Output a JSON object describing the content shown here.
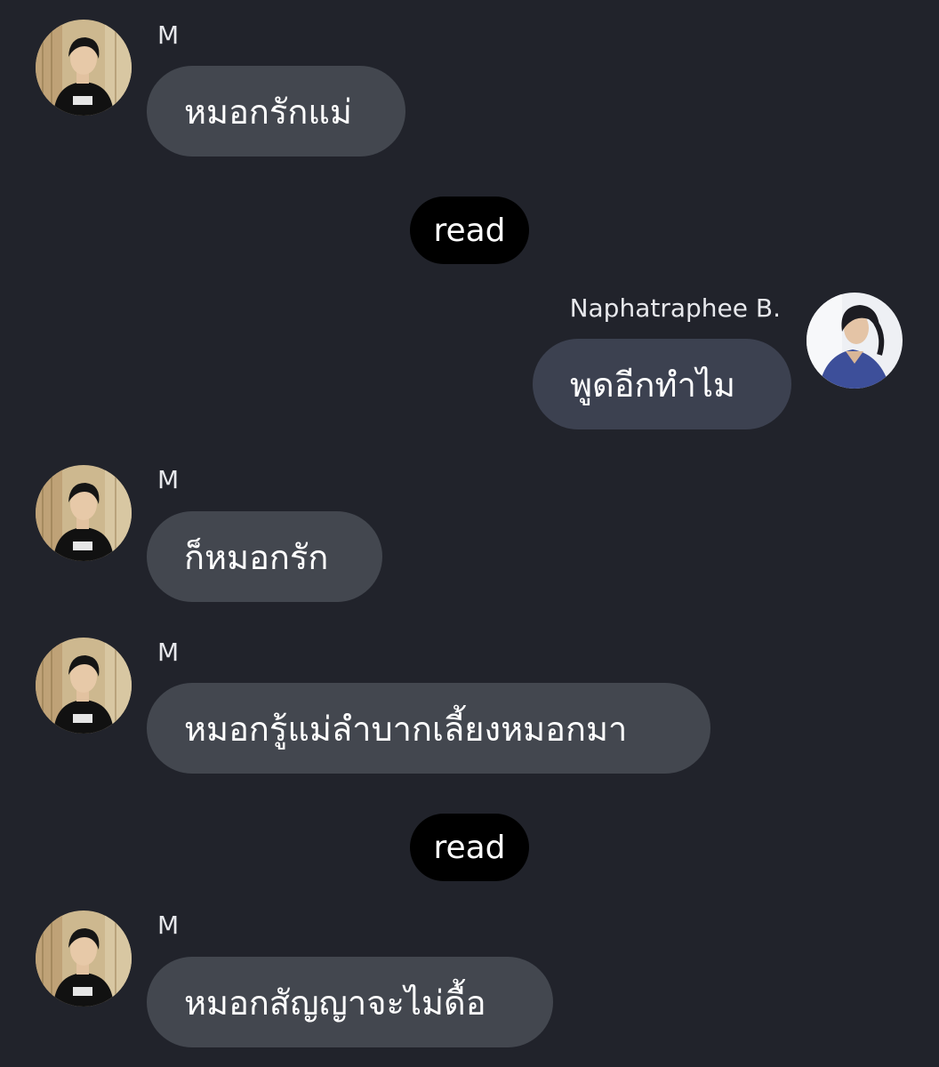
{
  "chat": {
    "participants": {
      "other": "M",
      "me": "Naphatraphee B."
    },
    "messages": [
      {
        "sender": "M",
        "text": "หมอกรักแม่"
      },
      {
        "receipt": "read"
      },
      {
        "sender": "Naphatraphee B.",
        "text": "พูดอีกทำไม"
      },
      {
        "sender": "M",
        "text": "ก็หมอกรัก"
      },
      {
        "sender": "M",
        "text": "หมอกรู้แม่ลำบากเลี้ยงหมอกมา"
      },
      {
        "receipt": "read"
      },
      {
        "sender": "M",
        "text": "หมอกสัญญาจะไม่ดื้อ"
      }
    ]
  },
  "colors": {
    "background": "#21232b",
    "bubble_other": "#43474f",
    "bubble_me": "#3c4150",
    "read_badge": "#000000",
    "text": "#ffffff"
  }
}
